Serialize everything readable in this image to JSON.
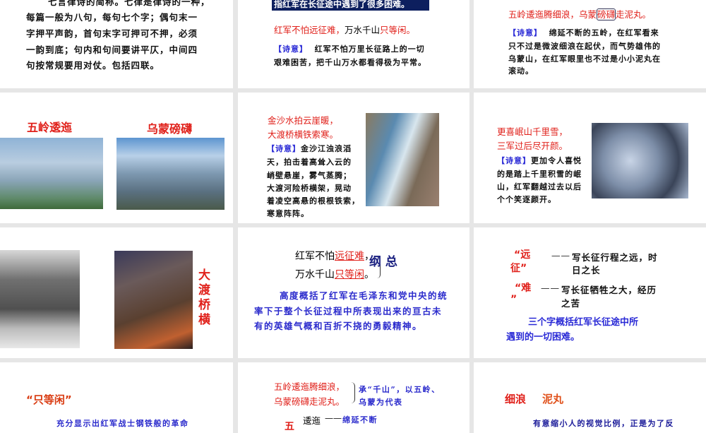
{
  "slides": [
    {
      "lines": [
        "七言律诗的简称。七律是律诗的一种，",
        "每篇一般为八句，每句七个字；偶句末一",
        "字押平声韵，首句末字可押可不押，必须",
        "一韵到底；句内和句间要讲平仄，中间四",
        "句按常规要用对仗。包括四联。"
      ]
    },
    {
      "banner": "指红军在长征途中遇到了很多困难。",
      "verse_red1": "红军不怕远征难，",
      "verse_black": "万水千山",
      "verse_red2": "只等闲。",
      "label": "【诗意】",
      "meaning1": "红军不怕万里长征路上的一切",
      "meaning2": "艰难困苦，把千山万水都看得极为平常。"
    },
    {
      "verse_a": "五岭逶迤腾细浪，乌蒙",
      "verse_box": "磅礴",
      "verse_b": "走泥丸。",
      "label": "【诗意】",
      "lines": [
        "绵延不断的五岭，在红军看来",
        "只不过是微波细浪在起伏，而气势雄伟的",
        "乌蒙山，在红军眼里也不过是小小泥丸在",
        "滚动。"
      ]
    },
    {
      "title1": "五岭逶迤",
      "title2": "乌蒙磅礴"
    },
    {
      "verse1": "金沙水拍云崖暖，",
      "verse2": "大渡桥横铁索寒。",
      "label": "【诗意】",
      "lines": [
        "金沙江浊浪滔",
        "天，拍击着高耸入云的",
        "峭壁悬崖，雾气蒸腾；",
        "大渡河险桥横架，晃动",
        "着凌空高悬的根根铁索，",
        "寒意阵阵。"
      ]
    },
    {
      "verse1": "更喜岷山千里雪，",
      "verse2": "三军过后尽开颜。",
      "label": "【诗意】",
      "lines": [
        "更加令人喜悦",
        "的是踏上千里积雪的岷",
        "山，红军翻越过去以后",
        "个个笑逐颜开。"
      ]
    },
    {
      "vertical": [
        "大",
        "渡",
        "桥",
        "横"
      ]
    },
    {
      "l1a": "红军不怕",
      "l1b": "远征难",
      "l1c": "，",
      "l2a": "万水千山",
      "l2b": "只等闲",
      "l2c": "。",
      "tag1": "纲",
      "tag2": "总",
      "lines": [
        "高度概括了红军在毛泽东和党中央的统",
        "率下于整个长征过程中所表现出来的亘古未",
        "有的英雄气概和百折不挠的勇毅精神。"
      ]
    },
    {
      "w1a": "“远",
      "w1b": "征”",
      "d1a": "写长征行程之远，时",
      "d1b": "日之长",
      "w2a": "“难",
      "w2b": "”",
      "d2a": "写长征牺牲之大，经历",
      "d2b": "之苦",
      "s1": "三个字概括红军长征途中所",
      "s2": "遇到的一切困难。",
      "dash": "——"
    },
    {
      "title": "“只等闲”",
      "line": "充分显示出红军战士钢铁般的革命"
    },
    {
      "v1": "五岭逶迤腾细浪，",
      "v2": "乌蒙磅礴走泥丸。",
      "n1": "承“千山”，以五岭、",
      "n2": "乌蒙为代表",
      "w": "逶迤",
      "wd": "绵延不断",
      "head": "五",
      "dash": "——"
    },
    {
      "t1": "细浪",
      "t2": "泥丸",
      "line": "有意缩小人的视觉比例，正是为了反"
    }
  ]
}
